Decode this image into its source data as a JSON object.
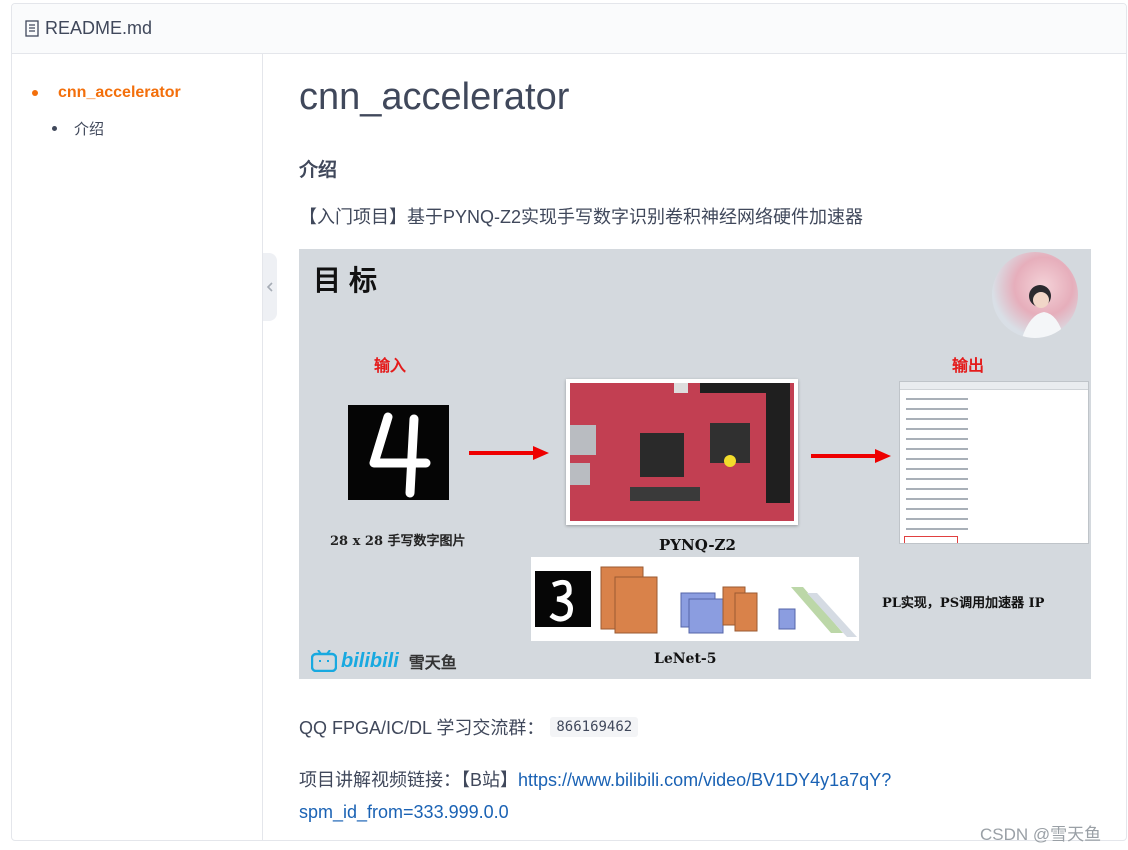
{
  "file_header": {
    "icon": "file-text-icon",
    "name": "README.md"
  },
  "toc": {
    "items": [
      {
        "label": "cnn_accelerator",
        "active": true
      },
      {
        "label": "介绍",
        "active": false
      }
    ]
  },
  "content": {
    "title": "cnn_accelerator",
    "section_heading": "介绍",
    "intro_text": "【入门项目】基于PYNQ-Z2实现手写数字识别卷积神经网络硬件加速器",
    "banner": {
      "title": "目标",
      "input_label": "输入",
      "output_label": "输出",
      "digit_caption": "28 x 28 手写数字图片",
      "board_caption": "PYNQ-Z2",
      "lenet_caption": "LeNet-5",
      "pl_caption": "PL实现，PS调用加速器 IP",
      "brand_logo": "bilibili",
      "brand_author": "雪天鱼"
    },
    "qq_label": "QQ FPGA/IC/DL 学习交流群：",
    "qq_number": "866169462",
    "video_label": "项目讲解视频链接：【B站】",
    "video_link": "https://www.bilibili.com/video/BV1DY4y1a7qY?spm_id_from=333.999.0.0"
  },
  "watermark": "CSDN @雪天鱼",
  "colors": {
    "accent": "#f36f0b",
    "link": "#1a62b4",
    "text": "#40485b"
  }
}
